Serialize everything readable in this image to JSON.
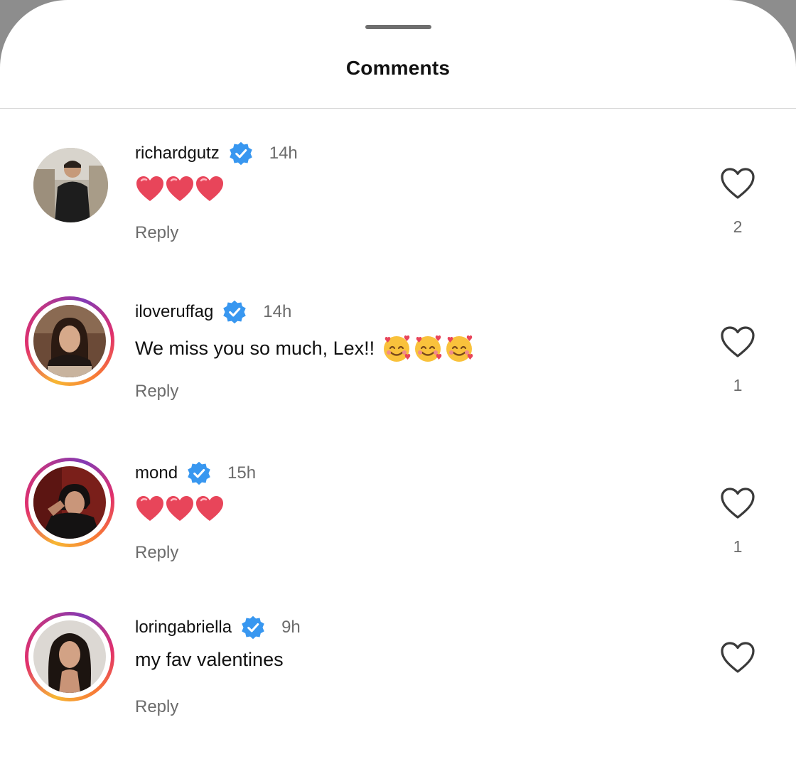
{
  "sheet": {
    "title": "Comments"
  },
  "comments": [
    {
      "username": "richardgutz",
      "verified": true,
      "time": "14h",
      "text": "",
      "emoji": [
        "red-heart",
        "red-heart",
        "red-heart"
      ],
      "reply_label": "Reply",
      "likes": "2",
      "story_ring": false
    },
    {
      "username": "iloveruffag",
      "verified": true,
      "time": "14h",
      "text": "We miss you so much, Lex!!",
      "emoji": [
        "smiling-face-with-hearts",
        "smiling-face-with-hearts",
        "smiling-face-with-hearts"
      ],
      "reply_label": "Reply",
      "likes": "1",
      "story_ring": true
    },
    {
      "username": "mond",
      "verified": true,
      "time": "15h",
      "text": "",
      "emoji": [
        "red-heart",
        "red-heart",
        "red-heart"
      ],
      "reply_label": "Reply",
      "likes": "1",
      "story_ring": true
    },
    {
      "username": "loringabriella",
      "verified": true,
      "time": "9h",
      "text": "my fav valentines",
      "emoji": [],
      "reply_label": "Reply",
      "likes": "",
      "story_ring": true
    }
  ],
  "colors": {
    "verified_badge": "#3897f0",
    "secondary_text": "#6b6b6b",
    "heart_emoji": "#e8455a"
  }
}
